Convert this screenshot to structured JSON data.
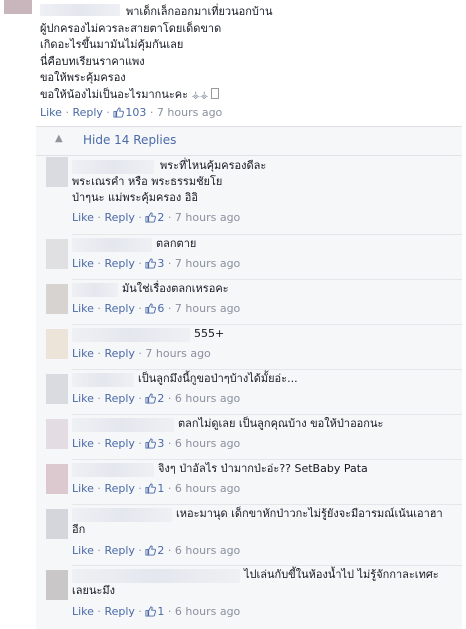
{
  "top_comment": {
    "lines": [
      "พาเด็กเล็กออกมาเที่ยวนอกบ้าน",
      "ผู้ปกครองไม่ควรละสายตาโดยเด็ดขาด",
      "เกิดอะไรขึ้นมามันไม่คุ้มกันเลย",
      "นี่คือบทเรียนราคาแพง",
      "ขอให้พระคุ้มครอง",
      "ขอให้น้องไม่เป็นอะไรมากนะคะ"
    ],
    "like": "Like",
    "reply": "Reply",
    "likes": "103",
    "time": "7 hours ago"
  },
  "toggle": {
    "label": "Hide 14 Replies",
    "icon": "caret-up-icon"
  },
  "colors": {
    "link": "#4a6aa8",
    "meta": "#8a90a0",
    "panel": "#f6f7f9"
  },
  "replies": [
    {
      "lines": [
        "พระที่ไหนคุ้มครองดีละ",
        "พระเณรคำ หรือ พระธรรมชัยโย",
        "ป่าๆนะ แม่พระคุ้มครอง อิอิ"
      ],
      "like": "Like",
      "reply": "Reply",
      "likes": "2",
      "time": "7 hours ago"
    },
    {
      "lines": [
        "ตลกตาย"
      ],
      "like": "Like",
      "reply": "Reply",
      "likes": "3",
      "time": "7 hours ago"
    },
    {
      "lines": [
        "มันใช่เรื่องตลกเหรอคะ"
      ],
      "like": "Like",
      "reply": "Reply",
      "likes": "6",
      "time": "7 hours ago"
    },
    {
      "lines": [
        "555+"
      ],
      "like": "Like",
      "reply": "Reply",
      "likes": "",
      "time": "7 hours ago"
    },
    {
      "lines": [
        "เป็นลูกมึงนี้กูขอป่าๆบ้างได้มั้ยอ่ะ..."
      ],
      "like": "Like",
      "reply": "Reply",
      "likes": "2",
      "time": "6 hours ago"
    },
    {
      "lines": [
        "ตลกไม่ดูเลย เป็นลูกคุณบ้าง ขอให้ป่าออกนะ"
      ],
      "like": "Like",
      "reply": "Reply",
      "likes": "3",
      "time": "6 hours ago"
    },
    {
      "lines": [
        "จิงๆ ป่าอัลไร ป่ามากป่ะอ่ะ?? SetBaby Pata"
      ],
      "like": "Like",
      "reply": "Reply",
      "likes": "1",
      "time": "6 hours ago"
    },
    {
      "lines": [
        "เหอะมานุด เด็กขาหักป่าวกะไม่รู้ยังจะมีอารมณ์เน้นเอาฮา",
        "อีก"
      ],
      "like": "Like",
      "reply": "Reply",
      "likes": "2",
      "time": "6 hours ago"
    },
    {
      "lines": [
        "ไปเล่นกับขี้ในห้องน้ำไป ไม่รู้จักกาละเทศะ",
        "เลยนะมึง"
      ],
      "like": "Like",
      "reply": "Reply",
      "likes": "1",
      "time": "6 hours ago"
    }
  ]
}
